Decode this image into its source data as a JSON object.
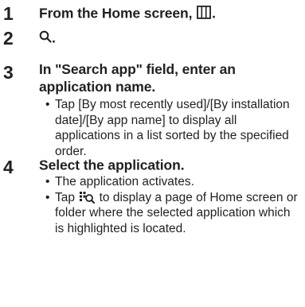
{
  "steps": [
    {
      "number": "1",
      "title_before": "From the Home screen, ",
      "title_icon": "apps-grid-icon",
      "title_after": "."
    },
    {
      "number": "2",
      "title_icon": "search-icon",
      "title_after": "."
    },
    {
      "number": "3",
      "title_line1": "In \"Search app\" field, enter an",
      "title_line2": "application name.",
      "bullets": [
        "Tap [By most recently used]/[By installation date]/[By app name] to display all applications in a list sorted by the specified order."
      ]
    },
    {
      "number": "4",
      "title": "Select the application.",
      "bullets": [
        "The application activates."
      ],
      "bullet2_before": "Tap ",
      "bullet2_icon": "locate-app-icon",
      "bullet2_after": " to display a page of Home screen or folder where the selected application which is highlighted is located."
    }
  ],
  "bullet_symbol": "•"
}
